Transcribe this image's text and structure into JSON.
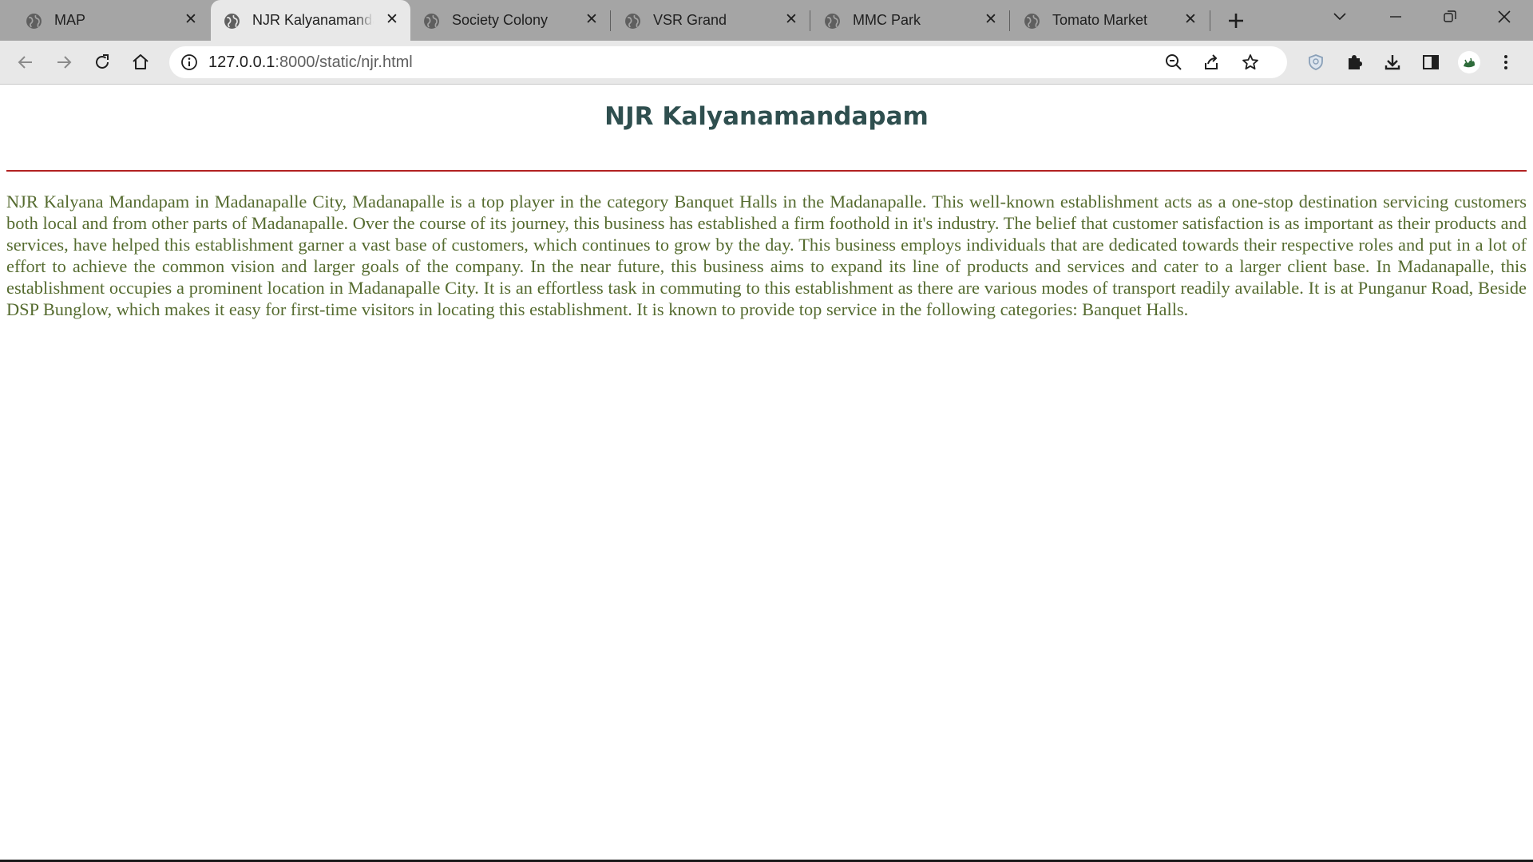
{
  "browser": {
    "tabs": [
      {
        "title": "MAP",
        "active": false
      },
      {
        "title": "NJR Kalyanamandapam",
        "active": true
      },
      {
        "title": "Society Colony",
        "active": false
      },
      {
        "title": "VSR Grand",
        "active": false
      },
      {
        "title": "MMC Park",
        "active": false
      },
      {
        "title": "Tomato Market",
        "active": false
      }
    ],
    "url_host": "127.0.0.1",
    "url_rest": ":8000/static/njr.html",
    "accent_color": "#1a73e8"
  },
  "page": {
    "title": "NJR Kalyanamandapam",
    "title_color": "#2f4f4f",
    "rule_color": "#b22222",
    "text_color": "#556b2f",
    "description": "NJR Kalyana Mandapam in Madanapalle City, Madanapalle is a top player in the category Banquet Halls in the Madanapalle. This well-known establishment acts as a one-stop destination servicing customers both local and from other parts of Madanapalle. Over the course of its journey, this business has established a firm foothold in it's industry. The belief that customer satisfaction is as important as their products and services, have helped this establishment garner a vast base of customers, which continues to grow by the day. This business employs individuals that are dedicated towards their respective roles and put in a lot of effort to achieve the common vision and larger goals of the company. In the near future, this business aims to expand its line of products and services and cater to a larger client base. In Madanapalle, this establishment occupies a prominent location in Madanapalle City. It is an effortless task in commuting to this establishment as there are various modes of transport readily available. It is at Punganur Road, Beside DSP Bunglow, which makes it easy for first-time visitors in locating this establishment. It is known to provide top service in the following categories: Banquet Halls."
  }
}
